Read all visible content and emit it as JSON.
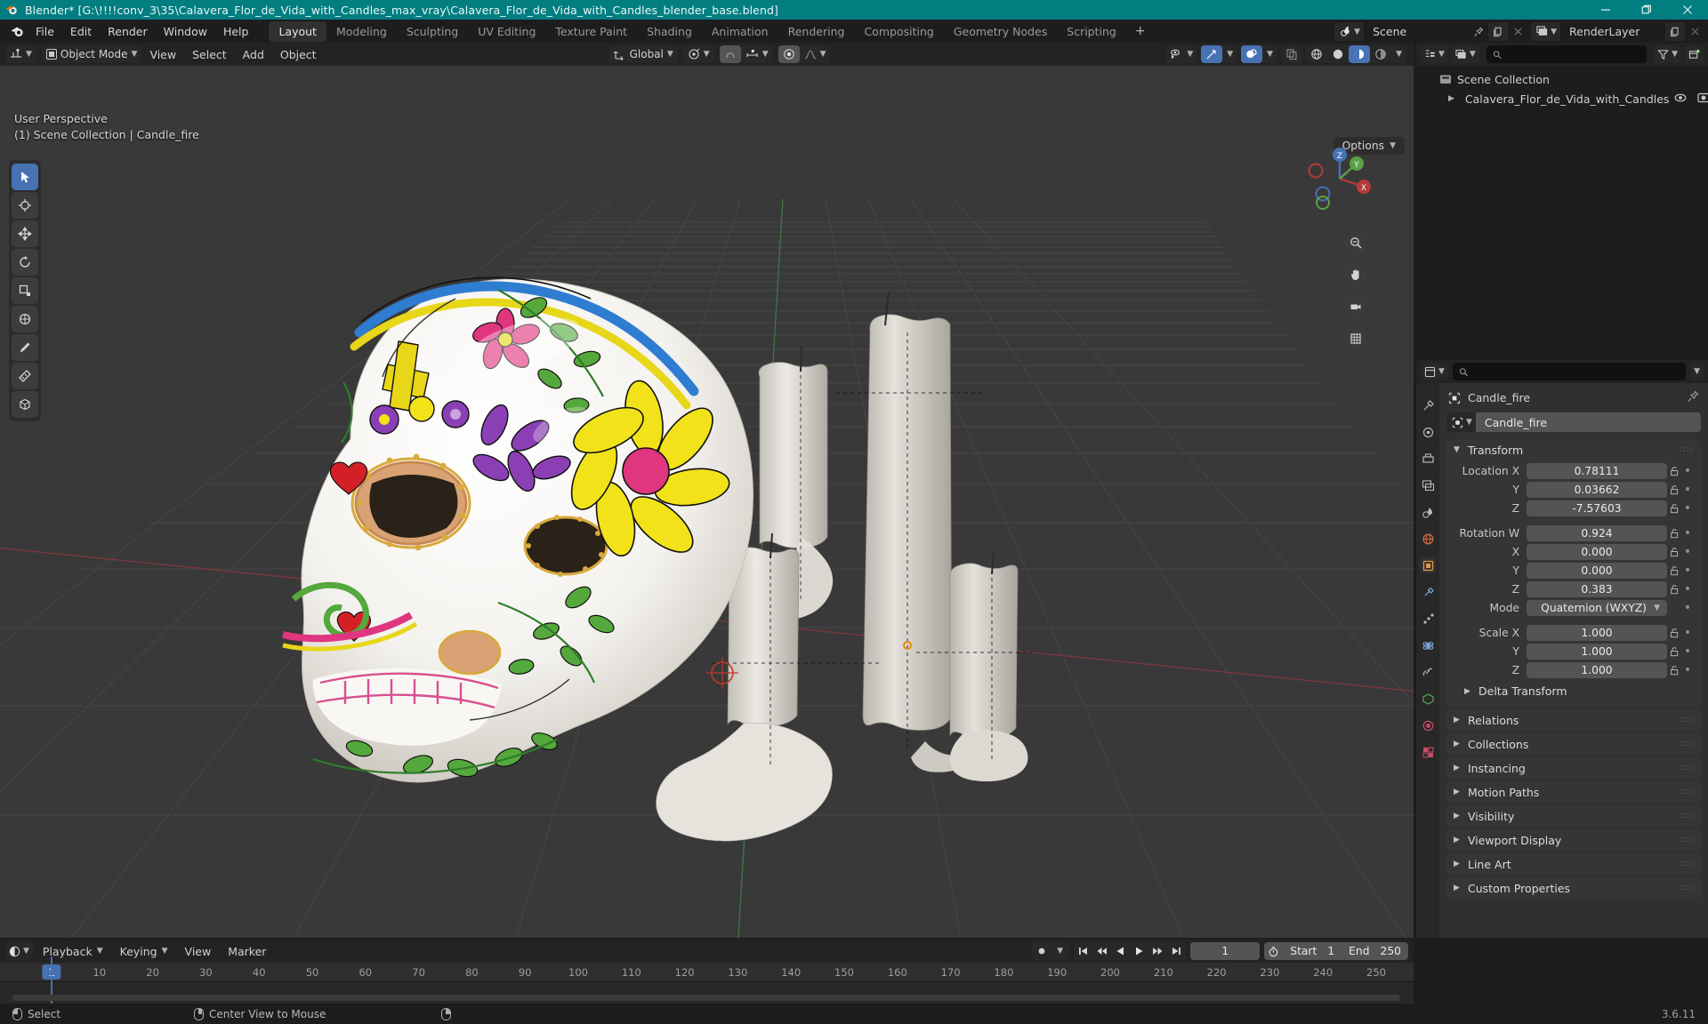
{
  "window": {
    "title": "Blender* [G:\\!!!!conv_3\\35\\Calavera_Flor_de_Vida_with_Candles_max_vray\\Calavera_Flor_de_Vida_with_Candles_blender_base.blend]",
    "minimize_label": "Minimize",
    "maximize_label": "Restore",
    "close_label": "Close"
  },
  "topbar": {
    "menus": [
      "File",
      "Edit",
      "Render",
      "Window",
      "Help"
    ],
    "workspaces": [
      {
        "label": "Layout",
        "active": true
      },
      {
        "label": "Modeling",
        "active": false
      },
      {
        "label": "Sculpting",
        "active": false
      },
      {
        "label": "UV Editing",
        "active": false
      },
      {
        "label": "Texture Paint",
        "active": false
      },
      {
        "label": "Shading",
        "active": false
      },
      {
        "label": "Animation",
        "active": false
      },
      {
        "label": "Rendering",
        "active": false
      },
      {
        "label": "Compositing",
        "active": false
      },
      {
        "label": "Geometry Nodes",
        "active": false
      },
      {
        "label": "Scripting",
        "active": false
      }
    ],
    "add_workspace": "+",
    "scene": "Scene",
    "view_layer": "RenderLayer"
  },
  "viewport": {
    "mode": "Object Mode",
    "menus": [
      "View",
      "Select",
      "Add",
      "Object"
    ],
    "transform_orientation": "Global",
    "overlay_text_line1": "User Perspective",
    "overlay_text_line2": "(1) Scene Collection | Candle_fire",
    "options_label": "Options",
    "gizmo_axes": {
      "x": "X",
      "y": "Y",
      "z": "Z"
    }
  },
  "outliner": {
    "display_mode": "view-layer-icon",
    "search_placeholder": "",
    "rows": [
      {
        "label": "Scene Collection",
        "indent": 0,
        "icon": "collection-icon",
        "expandable": false
      },
      {
        "label": "Calavera_Flor_de_Vida_with_Candles",
        "indent": 1,
        "icon": "empty-axes-icon",
        "expandable": true
      }
    ]
  },
  "properties": {
    "search_placeholder": "",
    "breadcrumb_object": "Candle_fire",
    "object_name": "Candle_fire",
    "transform": {
      "title": "Transform",
      "rows": [
        {
          "label": "Location X",
          "value": "0.78111",
          "lock": true
        },
        {
          "label": "Y",
          "value": "0.03662",
          "lock": true
        },
        {
          "label": "Z",
          "value": "-7.57603",
          "lock": true
        },
        {
          "label": "Rotation W",
          "value": "0.924",
          "lock": true,
          "gapBefore": true
        },
        {
          "label": "X",
          "value": "0.000",
          "lock": true
        },
        {
          "label": "Y",
          "value": "0.000",
          "lock": true
        },
        {
          "label": "Z",
          "value": "0.383",
          "lock": true
        },
        {
          "label": "Mode",
          "value": "Quaternion (WXYZ)",
          "lock": false,
          "dropdown": true
        },
        {
          "label": "Scale X",
          "value": "1.000",
          "lock": true,
          "gapBefore": true
        },
        {
          "label": "Y",
          "value": "1.000",
          "lock": true
        },
        {
          "label": "Z",
          "value": "1.000",
          "lock": true
        }
      ],
      "sub_panel": "Delta Transform"
    },
    "panels": [
      "Relations",
      "Collections",
      "Instancing",
      "Motion Paths",
      "Visibility",
      "Viewport Display",
      "Line Art",
      "Custom Properties"
    ],
    "tabs": [
      "tool-icon",
      "render-icon",
      "output-icon",
      "view-layer-icon",
      "scene-icon",
      "world-icon",
      "object-icon",
      "modifiers-icon",
      "particles-icon",
      "physics-icon",
      "constraints-icon",
      "data-icon",
      "material-icon",
      "texture-icon"
    ]
  },
  "timeline": {
    "menus": [
      "Playback",
      "Keying",
      "View",
      "Marker"
    ],
    "current_frame": "1",
    "start_label": "Start",
    "start_value": "1",
    "end_label": "End",
    "end_value": "250",
    "ticks": [
      10,
      20,
      30,
      40,
      50,
      60,
      70,
      80,
      90,
      100,
      110,
      120,
      130,
      140,
      150,
      160,
      170,
      180,
      190,
      200,
      210,
      220,
      230,
      240,
      250
    ],
    "playhead_frame": "1"
  },
  "statusbar": {
    "left_action": "Select",
    "mid_action": "Center View to Mouse",
    "version": "3.6.11"
  },
  "colors": {
    "title_bar": "#027e81",
    "accent_blue": "#4772b3",
    "viewport_bg": "#393939",
    "panel_bg": "#303030",
    "header_bg": "#232323"
  }
}
